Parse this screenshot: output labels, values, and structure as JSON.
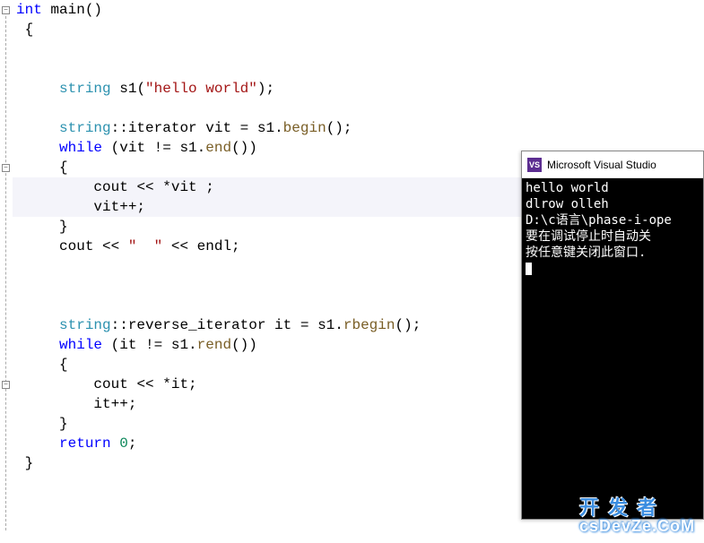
{
  "code": {
    "l1_int": "int",
    "l1_main": " main",
    "l1_paren": "()",
    "l2_brace": "{",
    "l4_string": "string",
    "l4_s1": " s1",
    "l4_paren_open": "(",
    "l4_literal": "\"hello world\"",
    "l4_paren_close": ")",
    "l4_semi": ";",
    "l6_string": "string",
    "l6_iter": "::iterator",
    "l6_vit": " vit ",
    "l6_assign": "=",
    "l6_s1": " s1.",
    "l6_begin": "begin",
    "l6_end": "();",
    "l7_while": "while",
    "l7_rest1": " (vit ",
    "l7_ne": "!=",
    "l7_rest2": " s1.",
    "l7_end_fn": "end",
    "l7_rest3": "())",
    "l8_brace": "{",
    "l9_cout": "cout ",
    "l9_op": "<<",
    "l9_rest": " *vit ;",
    "l10": "vit++;",
    "l11_brace": "}",
    "l12_cout": "cout ",
    "l12_op1": "<<",
    "l12_str": " \"  \" ",
    "l12_op2": "<<",
    "l12_endl": " endl;",
    "l15_string": "string",
    "l15_riter": "::reverse_iterator",
    "l15_it": " it ",
    "l15_eq": "=",
    "l15_s1": " s1.",
    "l15_rbegin": "rbegin",
    "l15_end": "();",
    "l16_while": "while",
    "l16_rest1": " (it ",
    "l16_ne": "!=",
    "l16_rest2": " s1.",
    "l16_rend": "rend",
    "l16_rest3": "())",
    "l17_brace": "{",
    "l18_cout": "cout ",
    "l18_op": "<<",
    "l18_rest": " *it;",
    "l19": "it++;",
    "l20_brace": "}",
    "l21_return": "return",
    "l21_zero": " 0",
    "l21_semi": ";",
    "l22_brace": "}"
  },
  "console": {
    "title": "Microsoft Visual Studio",
    "icon_label": "VS",
    "line1": "hello world",
    "line2": "dlrow olleh",
    "line3": "D:\\c语言\\phase-i-ope",
    "line4": "要在调试停止时自动关",
    "line5": "按任意键关闭此窗口."
  },
  "watermark": {
    "top": "开 发 者",
    "bottom": "csDevZe.CoM"
  }
}
